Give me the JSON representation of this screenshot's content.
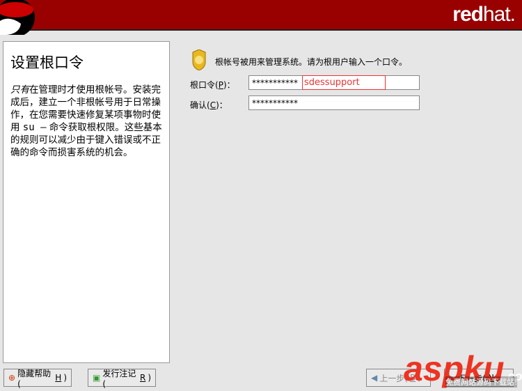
{
  "header": {
    "brand_bold": "red",
    "brand_light": "hat."
  },
  "help": {
    "title": "设置根口令",
    "body_em": "只有",
    "body": "在管理时才使用根帐号。安装完成后，建立一个非根帐号用于日常操作，在您需要快速修复某项事物时使用 ",
    "cmd": "su –",
    "body2": " 命令获取根权限。这些基本的规则可以减少由于键入错误或不正确的命令而损害系统的机会。"
  },
  "main": {
    "note": "根帐号被用来管理系统。请为根用户输入一个口令。",
    "password_label": "根口令(",
    "password_key": "P",
    "password_suffix": ")：",
    "password_value": "***********",
    "confirm_label": "确认(",
    "confirm_key": "C",
    "confirm_suffix": ")：",
    "confirm_value": "***********",
    "annotation": "sdessupport"
  },
  "buttons": {
    "hide_help": "隐藏帮助(",
    "hide_help_key": "H",
    "release_notes": "发行注记(",
    "release_notes_key": "R",
    "back": "上一步(",
    "back_key": "B",
    "next": "下一步(",
    "next_key": "N",
    "close": ")"
  },
  "watermark": {
    "logo": "aspku",
    "sub": "免费网站源码下载站!",
    "com": ".com"
  }
}
